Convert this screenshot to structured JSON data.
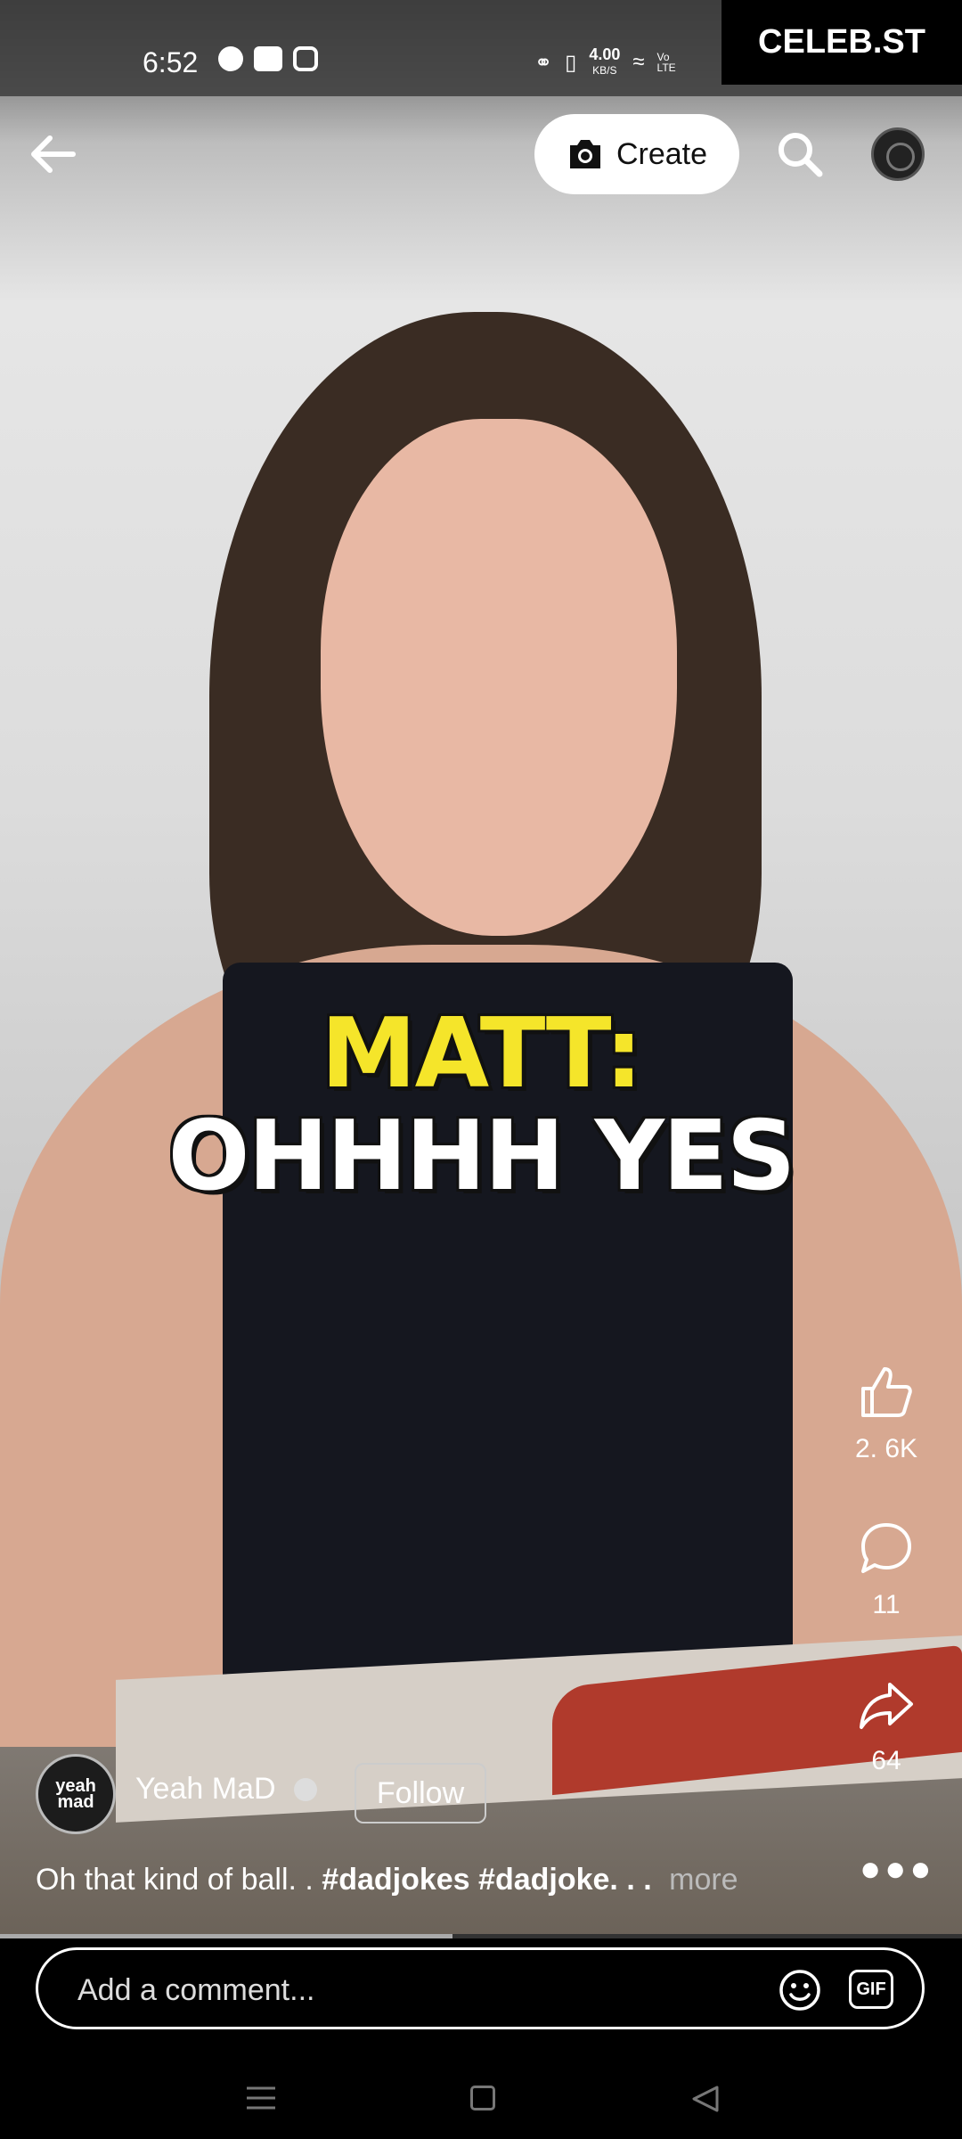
{
  "status_bar": {
    "time": "6:52",
    "network_speed": "4.00",
    "network_unit": "KB/S",
    "volte": "Vo LTE",
    "watermark": "CELEB.ST"
  },
  "top_bar": {
    "create_label": "Create"
  },
  "video": {
    "caption_line1": "MATT:",
    "caption_line2": "OHHHH YES",
    "progress_percent": 47
  },
  "actions": {
    "like_count": "2. 6K",
    "comment_count": "11",
    "share_count": "64"
  },
  "channel": {
    "avatar_text": "yeah mad",
    "name": "Yeah MaD",
    "follow_label": "Follow"
  },
  "description": {
    "text": "Oh that kind of ball. . ",
    "tags": "#dadjokes #dadjoke. . .",
    "more_label": "more"
  },
  "comment_box": {
    "placeholder": "Add a comment...",
    "gif_label": "GIF"
  },
  "colors": {
    "caption_yellow": "#f5e52a",
    "background": "#000000"
  }
}
